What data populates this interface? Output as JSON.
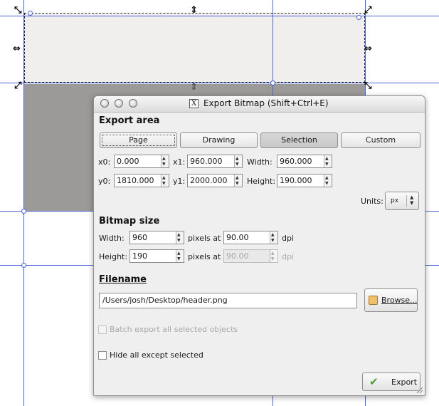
{
  "dialog": {
    "title": "Export Bitmap (Shift+Ctrl+E)",
    "export_area": {
      "heading": "Export area",
      "buttons": [
        "Page",
        "Drawing",
        "Selection",
        "Custom"
      ],
      "active": "Selection",
      "x0_label": "x0:",
      "x0": "0.000",
      "x1_label": "x1:",
      "x1": "960.000",
      "width_label": "Width:",
      "width": "960.000",
      "y0_label": "y0:",
      "y0": "1810.000",
      "y1_label": "y1:",
      "y1": "2000.000",
      "height_label": "Height:",
      "height": "190.000",
      "units_label": "Units:",
      "units": "px"
    },
    "bitmap_size": {
      "heading": "Bitmap size",
      "width_label": "Width:",
      "width": "960",
      "height_label": "Height:",
      "height": "190",
      "pixels_at": "pixels at",
      "dpi_x": "90.00",
      "dpi_y": "90.00",
      "dpi_label": "dpi"
    },
    "filename": {
      "heading": "Filename",
      "value": "/Users/josh/Desktop/header.png",
      "browse_label": "Browse..."
    },
    "batch_label": "Batch export all selected objects",
    "hide_label": "Hide all except selected",
    "export_label": "Export"
  },
  "colors": {
    "guide": "#4a63d8",
    "canvas_light": "#f0efed",
    "canvas_dark": "#9b9a98",
    "dialog_bg": "#efefef"
  }
}
